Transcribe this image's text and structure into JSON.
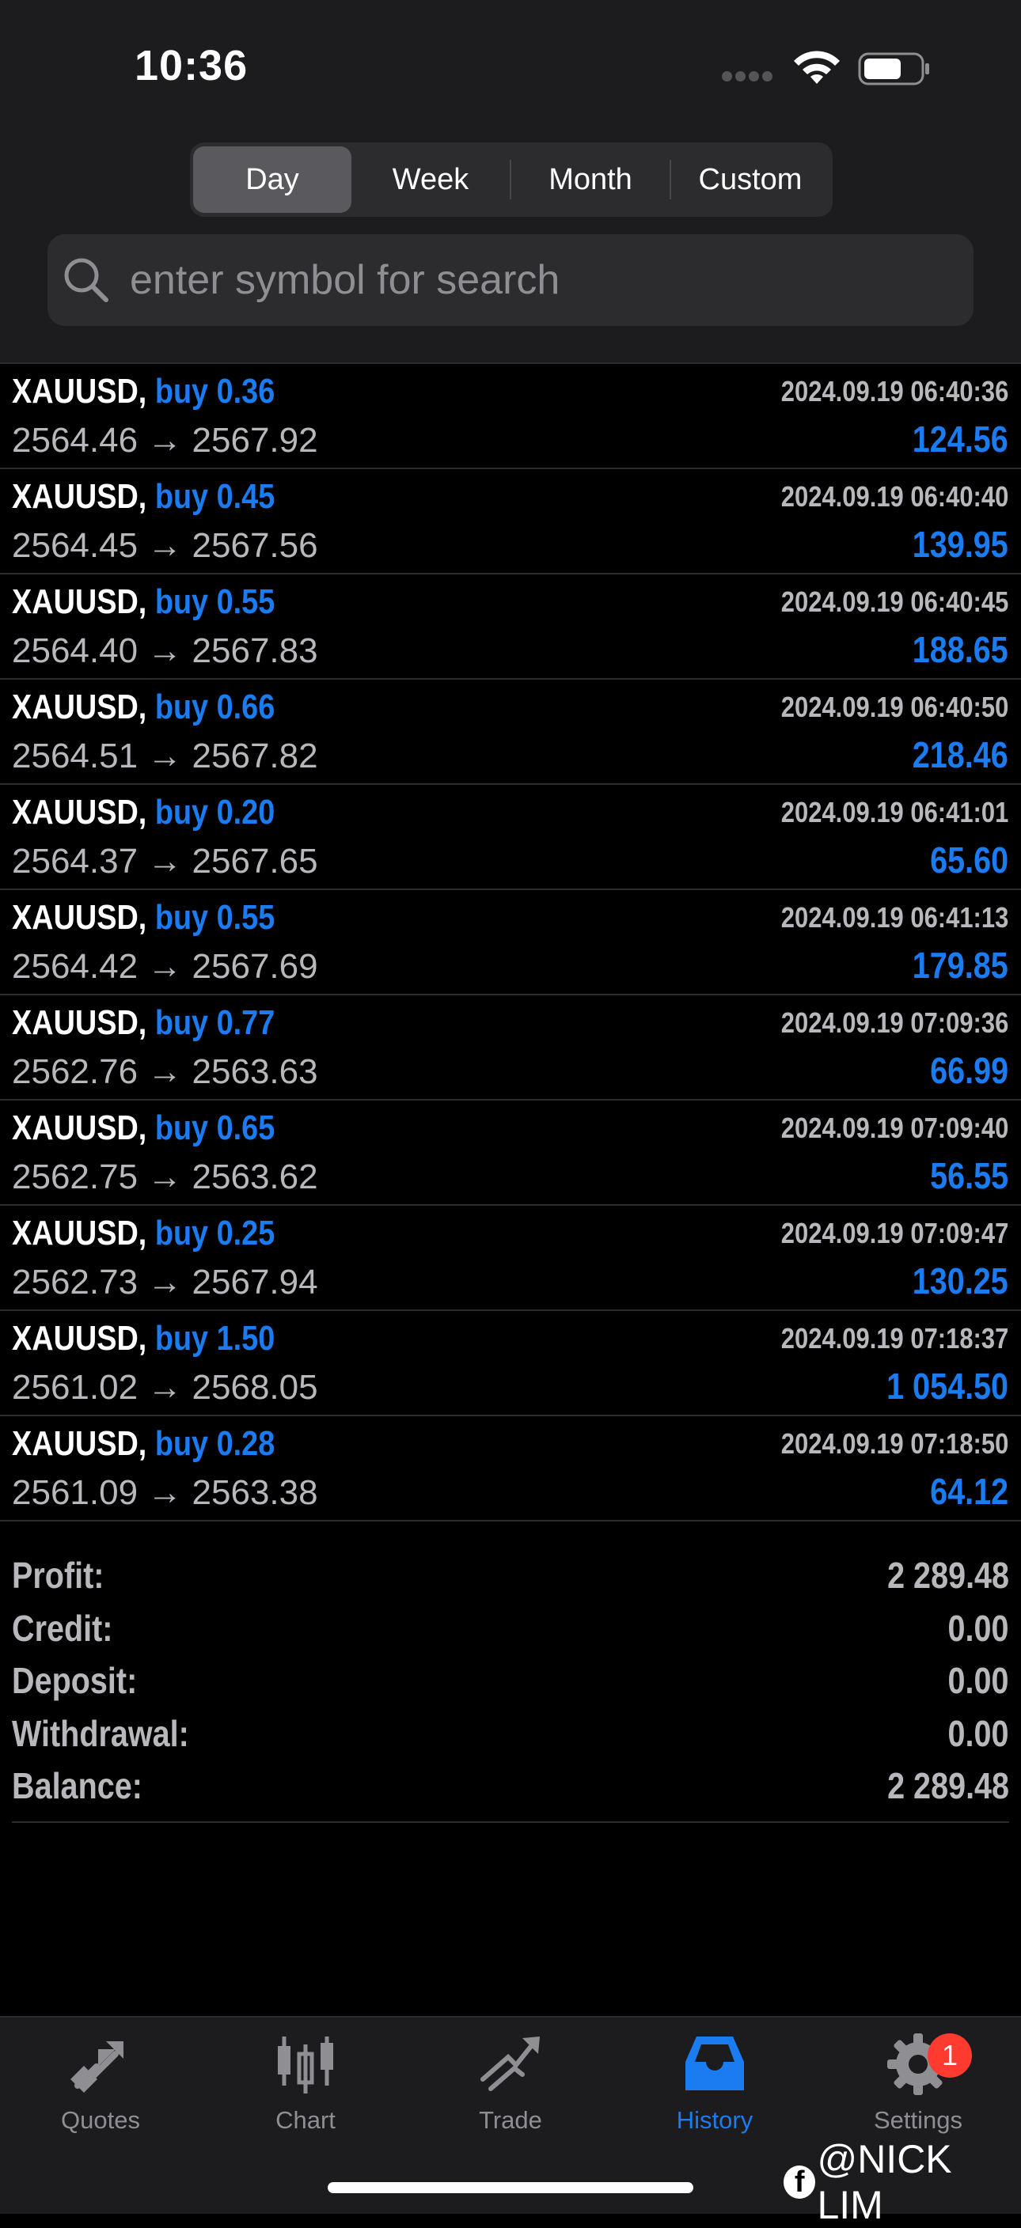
{
  "status": {
    "time": "10:36"
  },
  "periods": [
    "Day",
    "Week",
    "Month",
    "Custom"
  ],
  "active_period": "Day",
  "search": {
    "placeholder": "enter symbol for search"
  },
  "trades": [
    {
      "symbol": "XAUUSD,",
      "side": "buy 0.36",
      "open": "2564.46",
      "arrow": "→",
      "close": "2567.92",
      "datetime": "2024.09.19 06:40:36",
      "profit": "124.56"
    },
    {
      "symbol": "XAUUSD,",
      "side": "buy 0.45",
      "open": "2564.45",
      "arrow": "→",
      "close": "2567.56",
      "datetime": "2024.09.19 06:40:40",
      "profit": "139.95"
    },
    {
      "symbol": "XAUUSD,",
      "side": "buy 0.55",
      "open": "2564.40",
      "arrow": "→",
      "close": "2567.83",
      "datetime": "2024.09.19 06:40:45",
      "profit": "188.65"
    },
    {
      "symbol": "XAUUSD,",
      "side": "buy 0.66",
      "open": "2564.51",
      "arrow": "→",
      "close": "2567.82",
      "datetime": "2024.09.19 06:40:50",
      "profit": "218.46"
    },
    {
      "symbol": "XAUUSD,",
      "side": "buy 0.20",
      "open": "2564.37",
      "arrow": "→",
      "close": "2567.65",
      "datetime": "2024.09.19 06:41:01",
      "profit": "65.60"
    },
    {
      "symbol": "XAUUSD,",
      "side": "buy 0.55",
      "open": "2564.42",
      "arrow": "→",
      "close": "2567.69",
      "datetime": "2024.09.19 06:41:13",
      "profit": "179.85"
    },
    {
      "symbol": "XAUUSD,",
      "side": "buy 0.77",
      "open": "2562.76",
      "arrow": "→",
      "close": "2563.63",
      "datetime": "2024.09.19 07:09:36",
      "profit": "66.99"
    },
    {
      "symbol": "XAUUSD,",
      "side": "buy 0.65",
      "open": "2562.75",
      "arrow": "→",
      "close": "2563.62",
      "datetime": "2024.09.19 07:09:40",
      "profit": "56.55"
    },
    {
      "symbol": "XAUUSD,",
      "side": "buy 0.25",
      "open": "2562.73",
      "arrow": "→",
      "close": "2567.94",
      "datetime": "2024.09.19 07:09:47",
      "profit": "130.25"
    },
    {
      "symbol": "XAUUSD,",
      "side": "buy 1.50",
      "open": "2561.02",
      "arrow": "→",
      "close": "2568.05",
      "datetime": "2024.09.19 07:18:37",
      "profit": "1 054.50"
    },
    {
      "symbol": "XAUUSD,",
      "side": "buy 0.28",
      "open": "2561.09",
      "arrow": "→",
      "close": "2563.38",
      "datetime": "2024.09.19 07:18:50",
      "profit": "64.12"
    }
  ],
  "summary": [
    {
      "label": "Profit:",
      "value": "2 289.48"
    },
    {
      "label": "Credit:",
      "value": "0.00"
    },
    {
      "label": "Deposit:",
      "value": "0.00"
    },
    {
      "label": "Withdrawal:",
      "value": "0.00"
    },
    {
      "label": "Balance:",
      "value": "2 289.48"
    }
  ],
  "tabs": [
    {
      "label": "Quotes",
      "icon": "quotes-icon"
    },
    {
      "label": "Chart",
      "icon": "chart-icon"
    },
    {
      "label": "Trade",
      "icon": "trade-icon"
    },
    {
      "label": "History",
      "icon": "history-icon",
      "active": true
    },
    {
      "label": "Settings",
      "icon": "gear-icon",
      "badge": "1"
    }
  ],
  "watermark": {
    "text": "@NICK LIM",
    "icon": "f"
  },
  "colors": {
    "accent": "#1a7cf0",
    "background": "#000000",
    "header": "#1c1c1e",
    "badge": "#ff3b30"
  }
}
